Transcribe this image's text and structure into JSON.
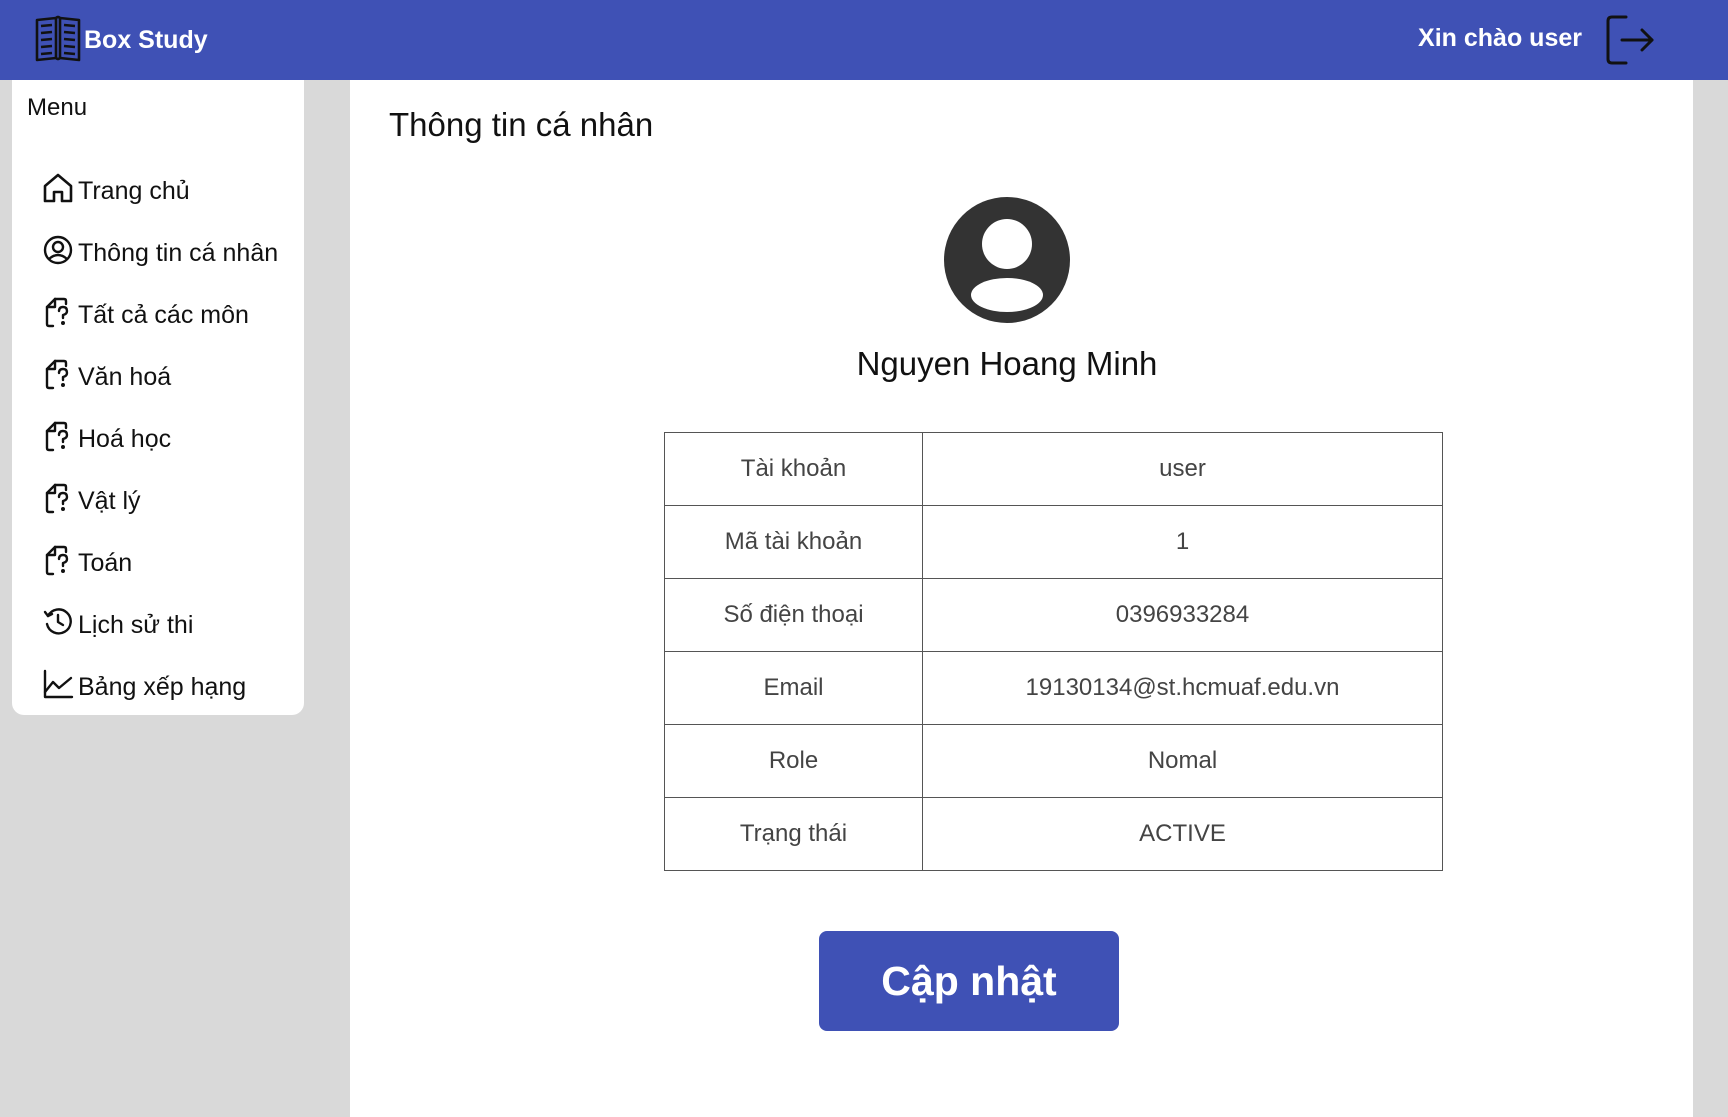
{
  "header": {
    "brand": "Box Study",
    "brand_icon": "book-icon",
    "greeting": "Xin chào user",
    "logout_icon": "logout-icon",
    "accent_color": "#3f51b5"
  },
  "sidebar": {
    "title": "Menu",
    "items": [
      {
        "label": "Trang chủ",
        "icon": "home-icon"
      },
      {
        "label": "Thông tin cá nhân",
        "icon": "user-circle-icon"
      },
      {
        "label": "Tất cả các môn",
        "icon": "question-file-icon"
      },
      {
        "label": "Văn hoá",
        "icon": "question-file-icon"
      },
      {
        "label": "Hoá học",
        "icon": "question-file-icon"
      },
      {
        "label": "Vật lý",
        "icon": "question-file-icon"
      },
      {
        "label": "Toán",
        "icon": "question-file-icon"
      },
      {
        "label": "Lịch sử thi",
        "icon": "history-icon"
      },
      {
        "label": "Bảng xếp hạng",
        "icon": "chart-line-icon"
      }
    ]
  },
  "main": {
    "title": "Thông tin cá nhân",
    "avatar_icon": "user-avatar-icon",
    "full_name": "Nguyen Hoang Minh",
    "rows": [
      {
        "label": "Tài khoản",
        "value": "user"
      },
      {
        "label": "Mã tài khoản",
        "value": "1"
      },
      {
        "label": "Số điện thoại",
        "value": "0396933284"
      },
      {
        "label": "Email",
        "value": "19130134@st.hcmuaf.edu.vn"
      },
      {
        "label": "Role",
        "value": "Nomal"
      },
      {
        "label": "Trạng thái",
        "value": "ACTIVE"
      }
    ],
    "update_label": "Cập nhật"
  }
}
